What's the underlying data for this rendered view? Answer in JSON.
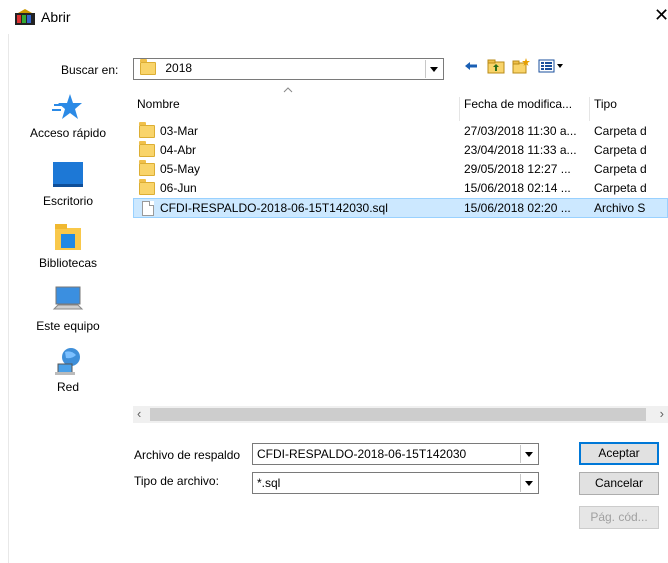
{
  "window": {
    "title": "Abrir",
    "close_glyph": "✕"
  },
  "lookin": {
    "label": "Buscar en:",
    "value": "2018"
  },
  "toolbar": {
    "icons": [
      "back-icon",
      "up-folder-icon",
      "new-folder-icon",
      "view-menu-icon"
    ]
  },
  "places": [
    {
      "label": "Acceso rápido",
      "icon": "star-icon"
    },
    {
      "label": "Escritorio",
      "icon": "desktop-icon"
    },
    {
      "label": "Bibliotecas",
      "icon": "libraries-icon"
    },
    {
      "label": "Este equipo",
      "icon": "computer-icon"
    },
    {
      "label": "Red",
      "icon": "network-icon"
    }
  ],
  "columns": {
    "name": "Nombre",
    "date": "Fecha de modifica...",
    "type": "Tipo"
  },
  "files": [
    {
      "name": "03-Mar",
      "date": "27/03/2018 11:30 a...",
      "type": "Carpeta d",
      "kind": "folder"
    },
    {
      "name": "04-Abr",
      "date": "23/04/2018 11:33 a...",
      "type": "Carpeta d",
      "kind": "folder"
    },
    {
      "name": "05-May",
      "date": "29/05/2018 12:27 ...",
      "type": "Carpeta d",
      "kind": "folder"
    },
    {
      "name": "06-Jun",
      "date": "15/06/2018 02:14 ...",
      "type": "Carpeta d",
      "kind": "folder"
    },
    {
      "name": "CFDI-RESPALDO-2018-06-15T142030.sql",
      "date": "15/06/2018 02:20 ...",
      "type": "Archivo S",
      "kind": "file",
      "selected": true
    }
  ],
  "filename": {
    "label": "Archivo de respaldo",
    "value": "CFDI-RESPALDO-2018-06-15T142030"
  },
  "filetype": {
    "label": "Tipo de archivo:",
    "value": "*.sql"
  },
  "buttons": {
    "ok": "Aceptar",
    "cancel": "Cancelar",
    "codepage": "Pág. cód..."
  },
  "colors": {
    "selection": "#cce8ff",
    "selection_border": "#99d1ff",
    "folder": "#f9d46a",
    "accent": "#0078d7"
  }
}
